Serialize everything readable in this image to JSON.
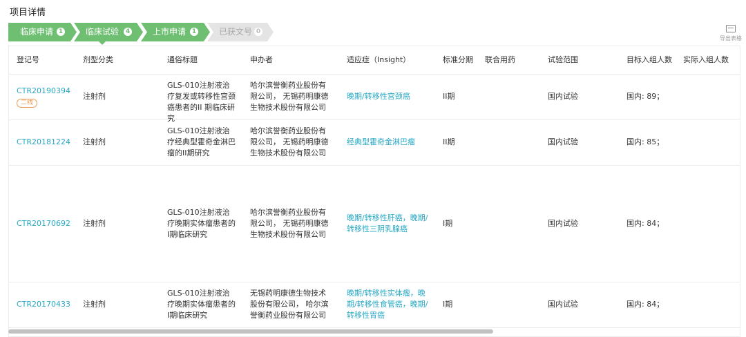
{
  "page": {
    "title": "项目详情"
  },
  "steps": [
    {
      "label": "临床申请",
      "count": "1"
    },
    {
      "label": "临床试验",
      "count": "4"
    },
    {
      "label": "上市申请",
      "count": "1"
    },
    {
      "label": "已获文号",
      "count": "0"
    }
  ],
  "toolbar": {
    "export_label": "导出表格",
    "export_icon": "table-export-icon"
  },
  "table": {
    "headers": [
      "登记号",
      "剂型分类",
      "通俗标题",
      "申办者",
      "适应症（Insight）",
      "标准分期",
      "联合用药",
      "试验范围",
      "目标入组人数",
      "实际入组人数"
    ],
    "rows": [
      {
        "reg": "CTR20190394",
        "tag": "二线",
        "form": "注射剂",
        "title": "GLS-010注射液治疗复发或转移性宫颈癌患者的II 期临床研究",
        "sponsor": "哈尔滨誉衡药业股份有限公司， 无锡药明康德生物技术股份有限公司",
        "indication": "晚期/转移性宫颈癌",
        "phase": "II期",
        "combo": "",
        "scope": "国内试验",
        "target": "国内: 89；",
        "actual": ""
      },
      {
        "reg": "CTR20181224",
        "form": "注射剂",
        "title": "GLS-010注射液治疗经典型霍奇金淋巴瘤的II期研究",
        "sponsor": "哈尔滨誉衡药业股份有限公司， 无锡药明康德生物技术股份有限公司",
        "indication": "经典型霍奇金淋巴瘤",
        "phase": "II期",
        "combo": "",
        "scope": "国内试验",
        "target": "国内: 85；",
        "actual": ""
      },
      {
        "reg": "CTR20170692",
        "form": "注射剂",
        "title": "GLS-010注射液治疗晚期实体瘤患者的I期临床研究",
        "sponsor": "哈尔滨誉衡药业股份有限公司， 无锡药明康德生物技术股份有限公司",
        "indication": "晚期/转移性肝癌，晚期/转移性三阴乳腺癌",
        "phase": "I期",
        "combo": "",
        "scope": "国内试验",
        "target": "国内: 84；",
        "actual": ""
      },
      {
        "reg": "CTR20170433",
        "form": "注射剂",
        "title": "GLS-010注射液治疗晚期实体瘤患者的I期临床研究",
        "sponsor": "无锡药明康德生物技术股份有限公司， 哈尔滨誉衡药业股份有限公司",
        "indication": "晚期/转移性实体瘤，晚期/转移性食管癌，晚期/转移性胃癌",
        "phase": "I期",
        "combo": "",
        "scope": "国内试验",
        "target": "国内: 84；",
        "actual": ""
      }
    ]
  },
  "colors": {
    "step_active": "#6fbf73",
    "step_inactive": "#e4e4e4",
    "link": "#27a7c4",
    "tag": "#e89b57"
  }
}
